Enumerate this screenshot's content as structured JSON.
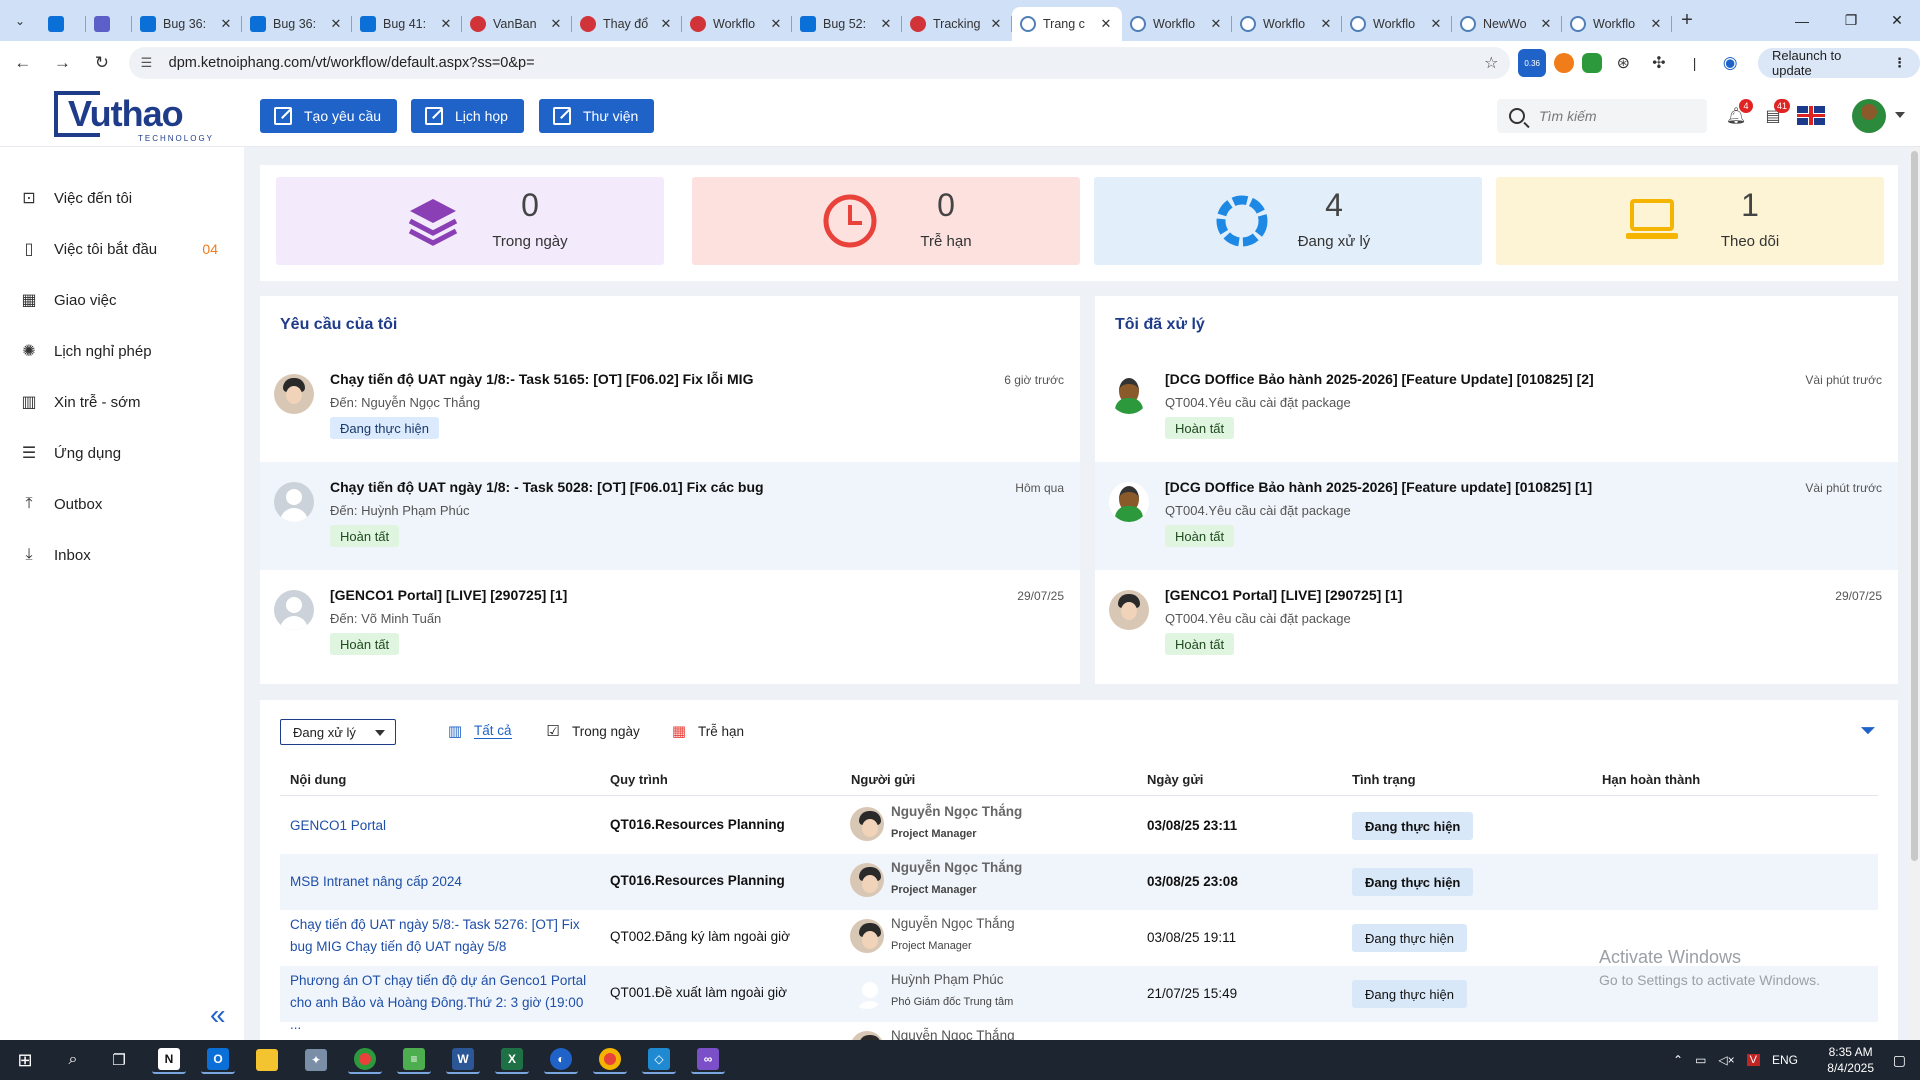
{
  "browser": {
    "tabs": [
      {
        "title": "",
        "icon": "azure",
        "active": false
      },
      {
        "title": "",
        "icon": "teams",
        "active": false
      },
      {
        "title": "Bug 36:",
        "icon": "azure",
        "active": false
      },
      {
        "title": "Bug 36:",
        "icon": "azure",
        "active": false
      },
      {
        "title": "Bug 41:",
        "icon": "azure",
        "active": false
      },
      {
        "title": "VanBan",
        "icon": "red",
        "active": false
      },
      {
        "title": "Thay đổ",
        "icon": "red",
        "active": false
      },
      {
        "title": "Workflo",
        "icon": "red",
        "active": false
      },
      {
        "title": "Bug 52:",
        "icon": "azure",
        "active": false
      },
      {
        "title": "Tracking",
        "icon": "red",
        "active": false
      },
      {
        "title": "Trang c",
        "icon": "web",
        "active": true
      },
      {
        "title": "Workflo",
        "icon": "web",
        "active": false
      },
      {
        "title": "Workflo",
        "icon": "web",
        "active": false
      },
      {
        "title": "Workflo",
        "icon": "web",
        "active": false
      },
      {
        "title": "NewWo",
        "icon": "web",
        "active": false
      },
      {
        "title": "Workflo",
        "icon": "web",
        "active": false
      }
    ],
    "url": "dpm.ketnoiphang.com/vt/workflow/default.aspx?ss=0&p=",
    "extension_badge": "0.36",
    "relaunch_label": "Relaunch to update"
  },
  "header": {
    "logo_text": "Vuthao",
    "logo_sub": "TECHNOLOGY",
    "buttons": [
      {
        "label": "Tạo yêu cầu"
      },
      {
        "label": "Lịch họp"
      },
      {
        "label": "Thư viện"
      }
    ],
    "search_placeholder": "Tìm kiếm",
    "notif_count": "4",
    "task_count": "41"
  },
  "sidebar": {
    "items": [
      {
        "label": "Việc đến tôi",
        "icon": "inbox-task-icon",
        "count": ""
      },
      {
        "label": "Việc tôi bắt đầu",
        "icon": "document-icon",
        "count": "04"
      },
      {
        "label": "Giao việc",
        "icon": "calendar-icon",
        "count": ""
      },
      {
        "label": "Lịch nghỉ phép",
        "icon": "holiday-icon",
        "count": ""
      },
      {
        "label": "Xin trễ - sớm",
        "icon": "timesheet-icon",
        "count": ""
      },
      {
        "label": "Ứng dụng",
        "icon": "list-icon",
        "count": ""
      },
      {
        "label": "Outbox",
        "icon": "upload-icon",
        "count": ""
      },
      {
        "label": "Inbox",
        "icon": "download-icon",
        "count": ""
      }
    ]
  },
  "stats": [
    {
      "value": "0",
      "label": "Trong ngày",
      "bg": "#f3eafb",
      "icon": "layers-icon",
      "color": "#8a3fb5"
    },
    {
      "value": "0",
      "label": "Trễ hạn",
      "bg": "#fde1df",
      "icon": "clock-icon",
      "color": "#e8423a"
    },
    {
      "value": "4",
      "label": "Đang xử lý",
      "bg": "#e2effb",
      "icon": "progress-ring-icon",
      "color": "#1e88e5"
    },
    {
      "value": "1",
      "label": "Theo dõi",
      "bg": "#fdf4d6",
      "icon": "laptop-icon",
      "color": "#f4b400"
    }
  ],
  "my_requests": {
    "title": "Yêu cầu của tôi",
    "items": [
      {
        "title": "Chạy tiến độ UAT ngày 1/8:- Task 5165: [OT] [F06.02] Fix lỗi MIG",
        "sub": "Đến: Nguyễn Ngọc Thắng",
        "status": "Đang thực hiện",
        "status_type": "doing",
        "time": "6 giờ trước",
        "avatar": "photo"
      },
      {
        "title": "Chạy tiến độ UAT ngày 1/8: - Task 5028: [OT] [F06.01] Fix các bug",
        "sub": "Đến: Huỳnh Phạm Phúc",
        "status": "Hoàn tất",
        "status_type": "done",
        "time": "Hôm qua",
        "avatar": "person"
      },
      {
        "title": "[GENCO1 Portal] [LIVE] [290725] [1]",
        "sub": "Đến: Võ Minh Tuấn",
        "status": "Hoàn tất",
        "status_type": "done",
        "time": "29/07/25",
        "avatar": "person"
      }
    ]
  },
  "processed": {
    "title": "Tôi đã xử lý",
    "items": [
      {
        "title": "[DCG DOffice Bảo hành 2025-2026] [Feature Update] [010825] [2]",
        "sub": "QT004.Yêu cầu cài đặt package",
        "status": "Hoàn tất",
        "status_type": "done",
        "time": "Vài phút trước",
        "avatar": "cartoon"
      },
      {
        "title": "[DCG DOffice Bảo hành 2025-2026] [Feature update] [010825] [1]",
        "sub": "QT004.Yêu cầu cài đặt package",
        "status": "Hoàn tất",
        "status_type": "done",
        "time": "Vài phút trước",
        "avatar": "cartoon"
      },
      {
        "title": "[GENCO1 Portal] [LIVE] [290725] [1]",
        "sub": "QT004.Yêu cầu cài đặt package",
        "status": "Hoàn tất",
        "status_type": "done",
        "time": "29/07/25",
        "avatar": "photo"
      }
    ]
  },
  "tasks": {
    "filter_value": "Đang xử lý",
    "tabs": [
      {
        "label": "Tất cả",
        "icon": "grid-icon",
        "selected": true
      },
      {
        "label": "Trong ngày",
        "icon": "calendar-check-icon",
        "selected": false
      },
      {
        "label": "Trễ hạn",
        "icon": "calendar-late-icon",
        "selected": false
      }
    ],
    "columns": [
      "Nội dung",
      "Quy trình",
      "Người gửi",
      "Ngày gửi",
      "Tình trạng",
      "Hạn hoàn thành"
    ],
    "rows": [
      {
        "content": "GENCO1 Portal",
        "process": "QT016.Resources Planning",
        "sender": "Nguyễn Ngọc Thắng",
        "role": "Project Manager",
        "date": "03/08/25 23:11",
        "status": "Đang thực hiện",
        "deadline": "",
        "bold": true,
        "avatar": "photo"
      },
      {
        "content": "MSB Intranet nâng cấp 2024",
        "process": "QT016.Resources Planning",
        "sender": "Nguyễn Ngọc Thắng",
        "role": "Project Manager",
        "date": "03/08/25 23:08",
        "status": "Đang thực hiện",
        "deadline": "",
        "bold": true,
        "avatar": "photo"
      },
      {
        "content": "Chạy tiến độ UAT ngày 5/8:- Task 5276: [OT] Fix bug MIG Chạy tiến độ UAT ngày 5/8",
        "process": "QT002.Đăng ký làm ngoài giờ",
        "sender": "Nguyễn Ngọc Thắng",
        "role": "Project Manager",
        "date": "03/08/25 19:11",
        "status": "Đang thực hiện",
        "deadline": "",
        "bold": false,
        "avatar": "photo"
      },
      {
        "content": "Phương án OT chạy tiến độ dự án Genco1 Portal cho anh Bảo và Hoàng Đông.Thứ 2: 3 giờ (19:00 ...",
        "process": "QT001.Đề xuất làm ngoài giờ",
        "sender": "Huỳnh Phạm Phúc",
        "role": "Phó Giám đốc Trung tâm",
        "date": "21/07/25 15:49",
        "status": "Đang thực hiện",
        "deadline": "",
        "bold": false,
        "avatar": "person"
      },
      {
        "content": "",
        "process": "",
        "sender": "Nguyễn Ngọc Thắng",
        "role": "",
        "date": "",
        "status": "",
        "deadline": "",
        "bold": false,
        "avatar": "photo"
      }
    ]
  },
  "watermark": {
    "line1": "Activate Windows",
    "line2": "Go to Settings to activate Windows."
  },
  "taskbar": {
    "lang": "ENG",
    "time": "8:35 AM",
    "date": "8/4/2025"
  }
}
